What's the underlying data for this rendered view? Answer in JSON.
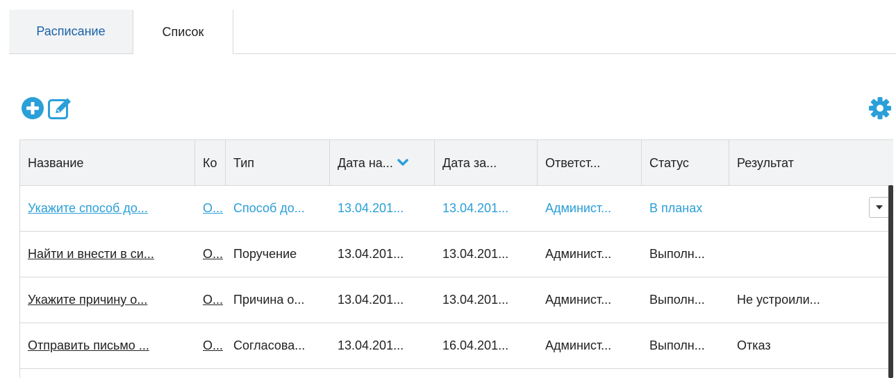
{
  "tabs": [
    {
      "label": "Расписание"
    },
    {
      "label": "Список"
    }
  ],
  "toolbar": {
    "add_icon": "plus-circle-icon",
    "edit_icon": "edit-icon",
    "settings_icon": "gear-icon"
  },
  "colors": {
    "accent": "#2a9fd8",
    "tab_link": "#1a62a8",
    "header_bg": "#f2f3f5"
  },
  "table": {
    "columns": [
      "Название",
      "Ко",
      "Тип",
      "Дата на...",
      "Дата за...",
      "Ответст...",
      "Статус",
      "Результат"
    ],
    "sort_icon": "chevron-down-icon",
    "rows": [
      {
        "name": "Укажите способ до...",
        "ko": "О...",
        "type": "Способ до...",
        "date_start": "13.04.201...",
        "date_end": "13.04.201...",
        "responsible": "Админист...",
        "status": "В планах",
        "result": ""
      },
      {
        "name": "Найти и внести в си...",
        "ko": "О...",
        "type": "Поручение",
        "date_start": "13.04.201...",
        "date_end": "13.04.201...",
        "responsible": "Админист...",
        "status": "Выполн...",
        "result": ""
      },
      {
        "name": "Укажите причину о...",
        "ko": "О...",
        "type": "Причина о...",
        "date_start": "13.04.201...",
        "date_end": "13.04.201...",
        "responsible": "Админист...",
        "status": "Выполн...",
        "result": "Не устроили..."
      },
      {
        "name": "Отправить письмо ...",
        "ko": "О...",
        "type": "Согласова...",
        "date_start": "13.04.201...",
        "date_end": "16.04.201...",
        "responsible": "Админист...",
        "status": "Выполн...",
        "result": "Отказ"
      }
    ]
  }
}
